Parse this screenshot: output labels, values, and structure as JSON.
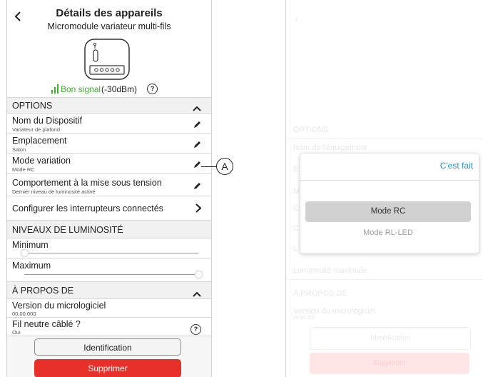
{
  "left_screen": {
    "header": {
      "title": "Détails des appareils",
      "subtitle": "Micromodule variateur multi-fils"
    },
    "signal": {
      "label": "Bon signal",
      "db": "(-30dBm)",
      "color": "#3dae2b"
    },
    "options": {
      "header": "OPTIONS",
      "items": [
        {
          "title": "Nom du Dispositif",
          "sub": "Variateur de plafond",
          "icon": "pencil-icon"
        },
        {
          "title": "Emplacement",
          "sub": "Salon",
          "icon": "pencil-icon"
        },
        {
          "title": "Mode variation",
          "sub": "Mode RC",
          "icon": "pencil-icon"
        },
        {
          "title": "Comportement à la mise sous tension",
          "sub": "Dernier niveau de luminosité activé",
          "icon": "pencil-icon"
        },
        {
          "title": "Configurer les interrupteurs connectés",
          "icon": "chevron-right-icon"
        }
      ]
    },
    "brightness": {
      "header": "NIVEAUX DE LUMINOSITÉ",
      "min_label": "Minimum",
      "max_label": "Maximum",
      "min_value": 0,
      "max_value": 1
    },
    "about": {
      "header": "À PROPOS DE",
      "firmware_label": "Version du micrologiciel",
      "firmware_value": "00.00.000",
      "neutral_label": "Fil neutre câblé ?",
      "neutral_value": "Oui"
    },
    "buttons": {
      "identify": "Identification",
      "delete": "Supprimer",
      "delete_color": "#e8302a"
    },
    "callout": "A"
  },
  "right_screen": {
    "background": {
      "options_header": "OPTIONS",
      "item1": "Nom de l'équipement",
      "item2_prefix": "E",
      "item3_prefix": "M",
      "item4_prefix": "C",
      "item5_prefix": "C",
      "item6_prefix": "L",
      "brightness_max": "Luminosité maximale",
      "about_header": "À PROPOS DE",
      "firmware_label": "Version du micrologiciel",
      "firmware_value": "00.00.000",
      "identify": "Identification",
      "delete": "Supprimer"
    },
    "dialog": {
      "done": "C'est fait",
      "options": [
        "Mode RC",
        "Mode RL-LED"
      ],
      "selected": "Mode RC",
      "accent": "#2d8fd2"
    }
  }
}
